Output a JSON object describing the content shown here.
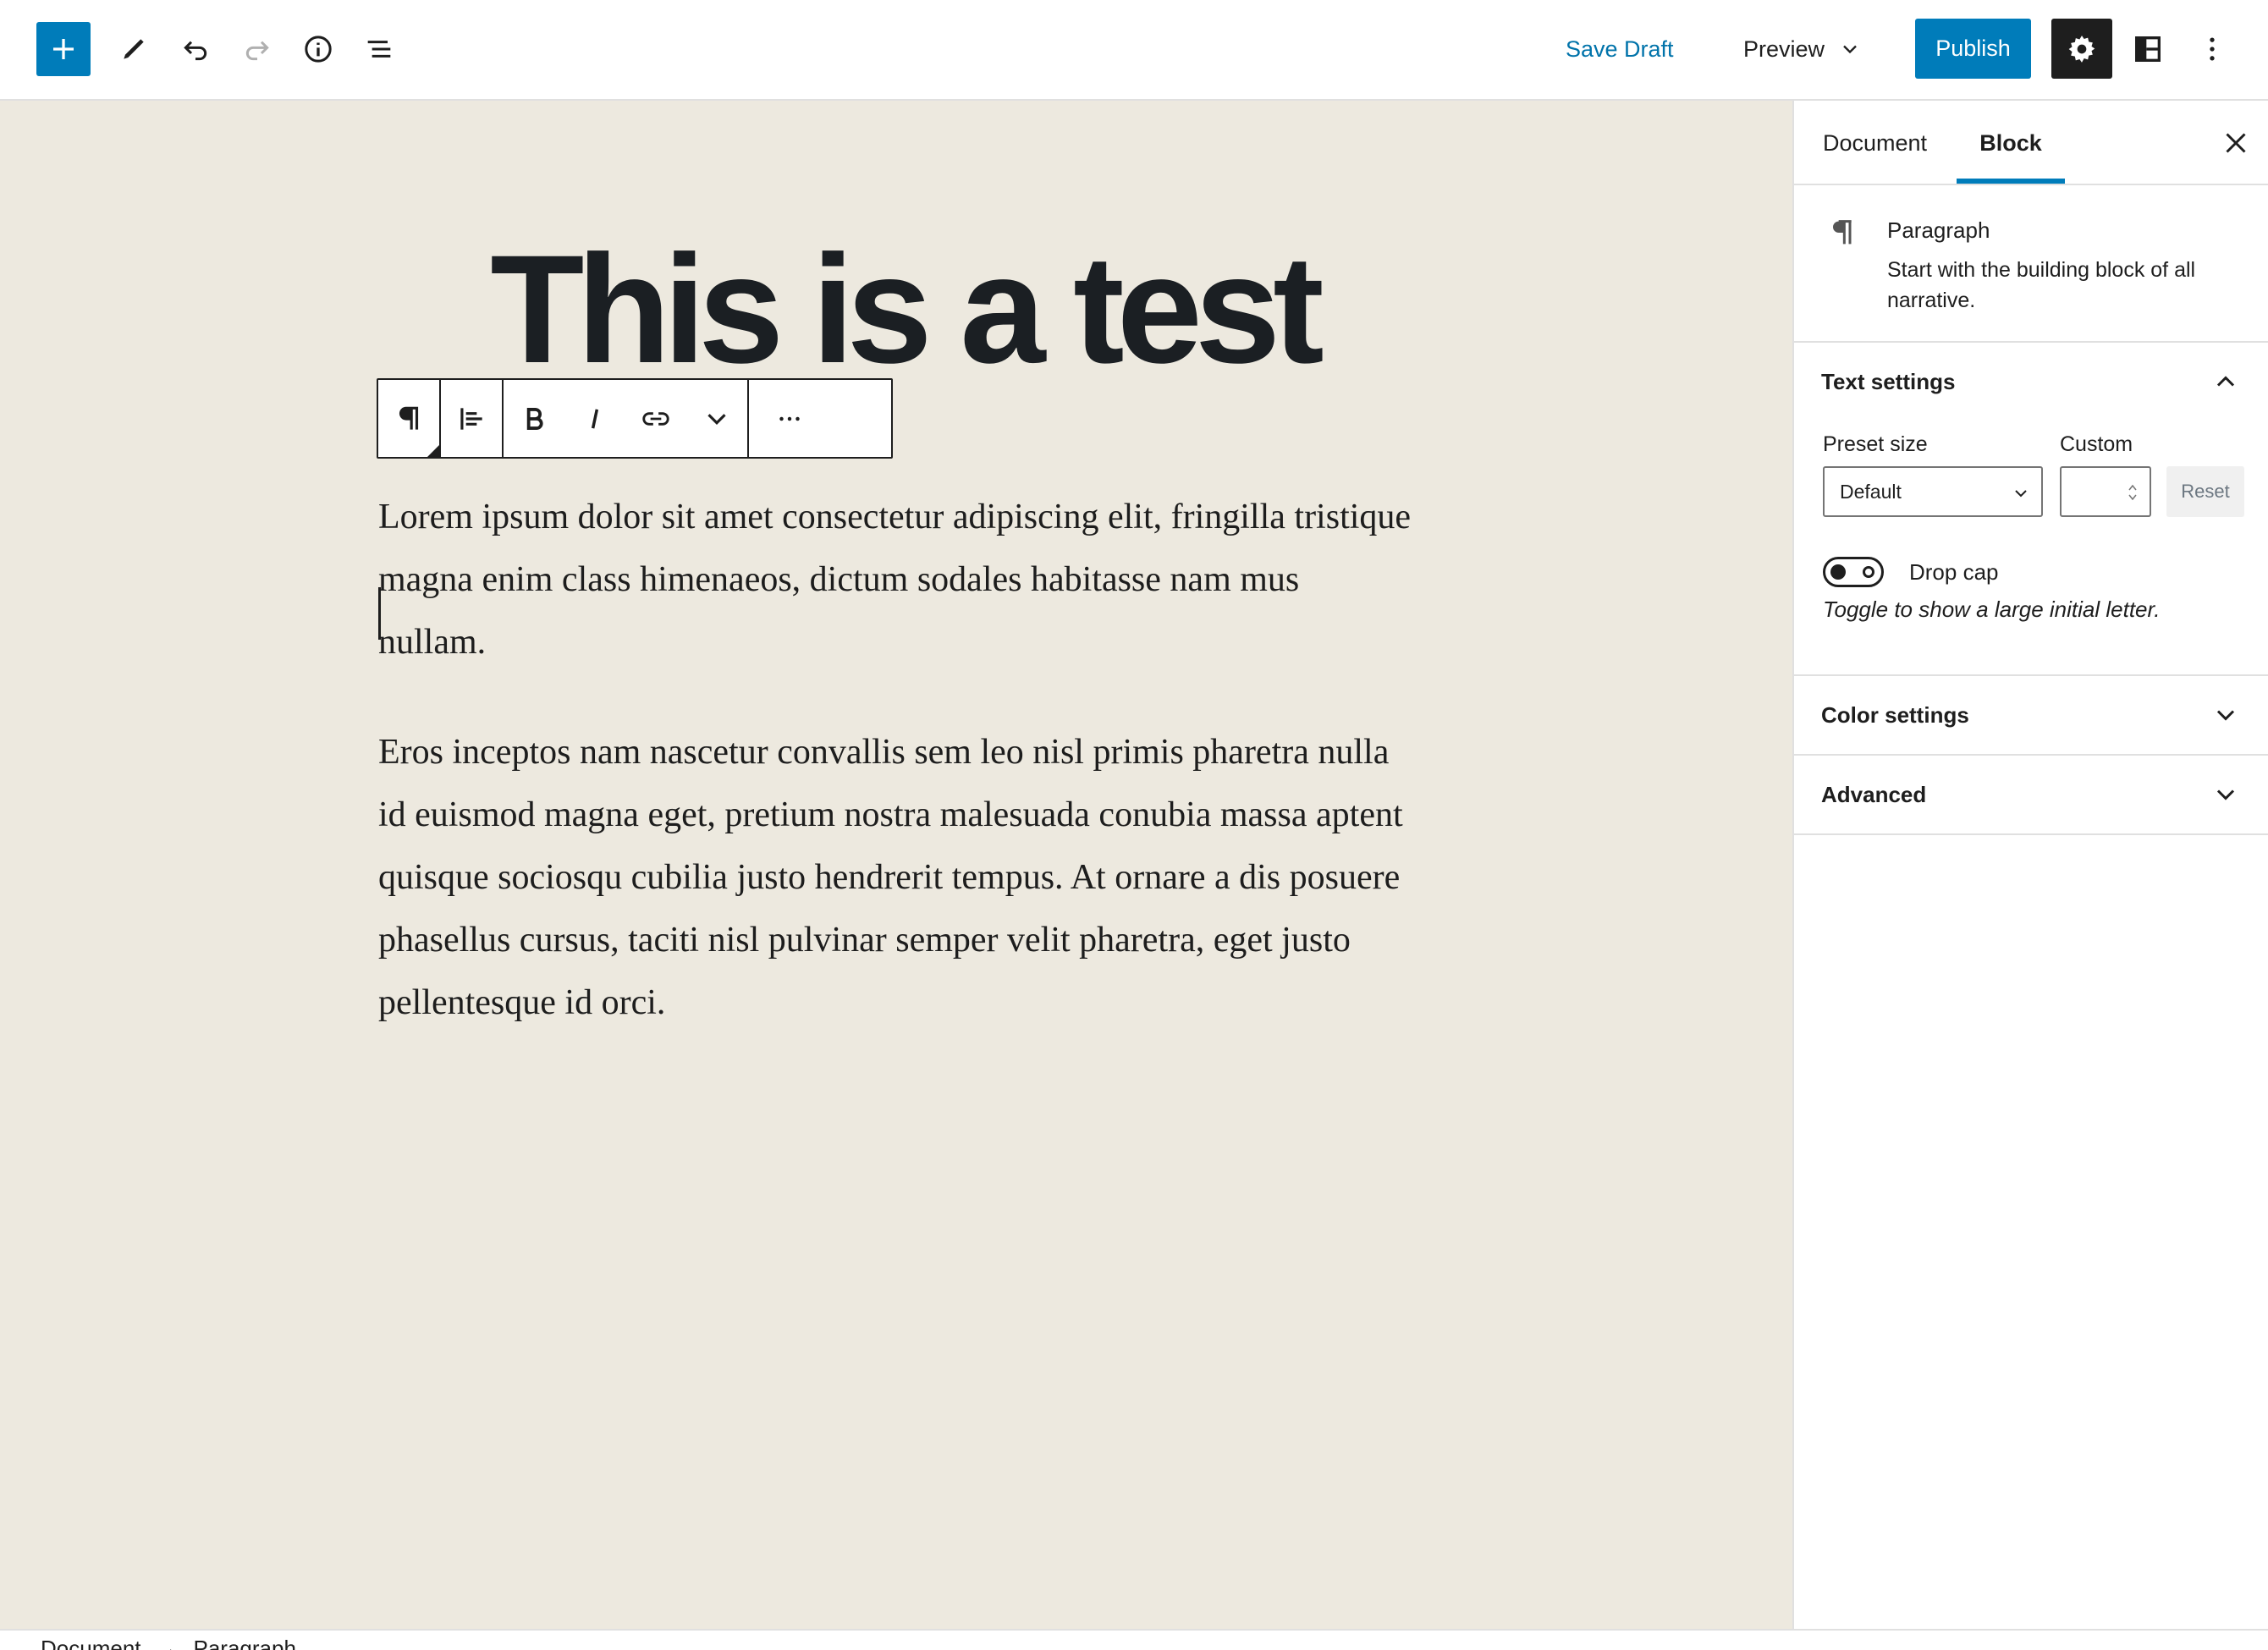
{
  "toolbar": {
    "save_draft": "Save Draft",
    "preview": "Preview",
    "publish": "Publish"
  },
  "editor": {
    "title": "This is a test",
    "paragraphs": [
      "Lorem ipsum dolor sit amet consectetur adipiscing elit, fringilla tristique magna enim class himenaeos, dictum sodales habitasse nam mus nullam.",
      "Eros inceptos nam nascetur convallis sem leo nisl primis pharetra nulla id euismod magna eget, pretium nostra malesuada conubia massa aptent quisque sociosqu cubilia justo hendrerit tempus. At ornare a dis posuere phasellus cursus, taciti nisl pulvinar semper velit pharetra, eget justo pellentesque id orci."
    ]
  },
  "sidebar": {
    "tabs": [
      "Document",
      "Block"
    ],
    "active_tab": "Block",
    "block": {
      "name": "Paragraph",
      "description": "Start with the building block of all narrative."
    },
    "text_settings": {
      "heading": "Text settings",
      "preset_label": "Preset size",
      "preset_value": "Default",
      "custom_label": "Custom",
      "custom_value": "",
      "reset": "Reset",
      "drop_cap_label": "Drop cap",
      "drop_cap_enabled": false,
      "drop_cap_help": "Toggle to show a large initial letter."
    },
    "color_settings": "Color settings",
    "advanced": "Advanced"
  },
  "breadcrumb": [
    "Document",
    "→",
    "Paragraph"
  ],
  "colors": {
    "accent": "#007cba",
    "canvas_bg": "#ede9df",
    "dark": "#1e1e1e"
  }
}
